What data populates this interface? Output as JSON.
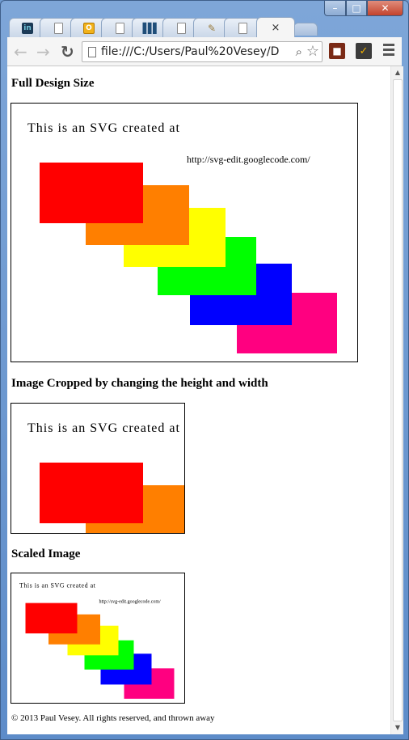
{
  "tabs": [
    {
      "icon": "linkedin-icon",
      "glyph": "in"
    },
    {
      "icon": "page-icon",
      "glyph": ""
    },
    {
      "icon": "outlook-icon",
      "glyph": "O"
    },
    {
      "icon": "page-icon",
      "glyph": ""
    },
    {
      "icon": "books-icon",
      "glyph": "▌▌▌"
    },
    {
      "icon": "page-icon",
      "glyph": ""
    },
    {
      "icon": "tool-icon",
      "glyph": "✎"
    },
    {
      "icon": "page-icon",
      "glyph": ""
    }
  ],
  "active_tab": {
    "close_glyph": "×"
  },
  "window": {
    "min": "–",
    "max": "□",
    "close": "✕"
  },
  "toolbar": {
    "back": "←",
    "forward": "→",
    "reload": "↻",
    "url": "file:///C:/Users/Paul%20Vesey/D",
    "zoom": "⌕",
    "star": "☆"
  },
  "page": {
    "section1_title": "Full Design Size",
    "section2_title": "Image Cropped by changing the height and width",
    "section3_title": "Scaled Image",
    "svg_text": "This is an SVG created at",
    "svg_url": "http://svg-edit.googlecode.com/",
    "footer": "© 2013 Paul Vesey. All rights reserved, and thrown away"
  },
  "colors": {
    "red": "#ff0000",
    "orange": "#ff7f00",
    "yellow": "#ffff00",
    "green": "#00ff00",
    "blue": "#0000ff",
    "pink": "#ff0080"
  }
}
